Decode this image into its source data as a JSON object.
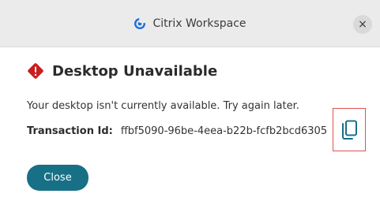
{
  "window": {
    "title": "Citrix Workspace",
    "close_glyph": "×",
    "app_icon": "citrix-logo-icon",
    "accent_color": "#187086"
  },
  "dialog": {
    "heading": "Desktop Unavailable",
    "heading_icon": "warning-diamond-icon",
    "heading_icon_color": "#c91f1f",
    "message": "Your desktop isn't currently available. Try again later.",
    "transaction_label": "Transaction Id:",
    "transaction_id": "ffbf5090-96be-4eea-b22b-fcfb2bcd6305",
    "copy_icon": "copy-icon",
    "highlight_color": "#e05050",
    "close_button_label": "Close"
  }
}
